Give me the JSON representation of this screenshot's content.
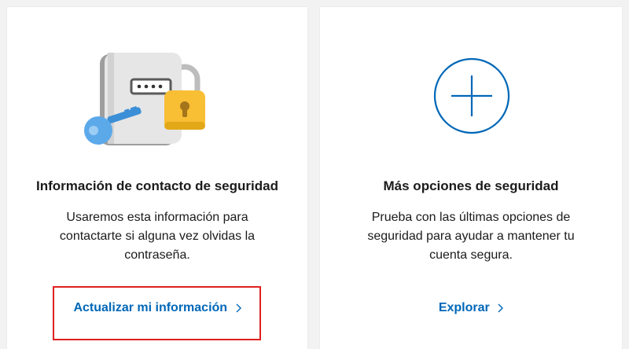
{
  "cards": [
    {
      "title": "Información de contacto de seguridad",
      "description": "Usaremos esta información para contactarte si alguna vez olvidas la contraseña.",
      "action_label": "Actualizar mi información",
      "illustration": "security-info-icon"
    },
    {
      "title": "Más opciones de seguridad",
      "description": "Prueba con las últimas opciones de seguridad para ayudar a mantener tu cuenta segura.",
      "action_label": "Explorar",
      "illustration": "plus-icon"
    }
  ],
  "colors": {
    "link": "#0067b8",
    "highlight": "#e02020",
    "background": "#f2f2f2",
    "card": "#ffffff"
  }
}
